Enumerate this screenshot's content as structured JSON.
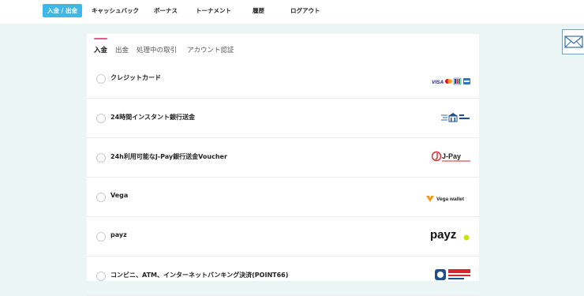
{
  "nav": {
    "items": [
      {
        "label": "入金 / 出金",
        "active": true
      },
      {
        "label": "キャッシュバック",
        "active": false
      },
      {
        "label": "ボーナス",
        "active": false
      },
      {
        "label": "トーナメント",
        "active": false
      },
      {
        "label": "履歴",
        "active": false
      },
      {
        "label": "ログアウト",
        "active": false
      }
    ]
  },
  "tabs": [
    {
      "label": "入金",
      "active": true
    },
    {
      "label": "出金",
      "active": false
    },
    {
      "label": "処理中の取引",
      "active": false
    },
    {
      "label": "アカウント認証",
      "active": false
    }
  ],
  "methods": [
    {
      "label": "クレジットカード",
      "logo": "card-brands-logo"
    },
    {
      "label": "24時間インスタント銀行送金",
      "logo": "bank-transfer-logo"
    },
    {
      "label": "24h利用可能なJ-Pay銀行送金Voucher",
      "logo": "jpay-logo",
      "logo_text": "J-Pay"
    },
    {
      "label": "Vega",
      "logo": "vega-wallet-logo",
      "logo_text": "Vega wallet"
    },
    {
      "label": "payz",
      "logo": "payz-logo",
      "logo_text": "payz"
    },
    {
      "label": "コンビニ、ATM、インターネットバンキング決済(POINT66)",
      "logo": "point66-logo"
    }
  ],
  "colors": {
    "accent": "#3fb8e8",
    "tab_indicator": "#e85a8a",
    "background": "#eaf5f4"
  }
}
